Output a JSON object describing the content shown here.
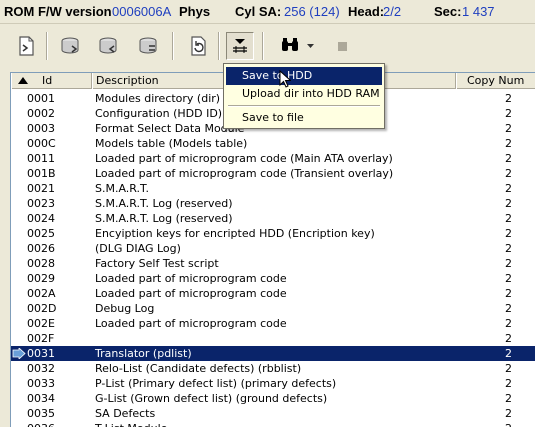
{
  "status": {
    "rom_label": "ROM F/W version",
    "rom_value": "0006006A",
    "phys_label": "Phys",
    "cyl_label": "Cyl SA:",
    "cyl_value": "256 (124)",
    "head_label": "Head:",
    "head_value": "2/2",
    "sec_label": "Sec:",
    "sec_value": "1 437"
  },
  "toolbar": {
    "buttons": [
      "read-module-icon",
      "hdd-read-icon",
      "hdd-write-icon",
      "hdd-compare-icon",
      "refresh-icon",
      "save-dropdown-icon",
      "binoculars-icon",
      "stop-icon"
    ]
  },
  "table": {
    "columns": [
      "Id",
      "Description",
      "Copy Num"
    ],
    "rows": [
      {
        "id": "0001",
        "desc": "Modules directory (dir)",
        "num": "2"
      },
      {
        "id": "0002",
        "desc": "Configuration (HDD ID) (Pa",
        "num": "2"
      },
      {
        "id": "0003",
        "desc": "Format Select Data Module",
        "num": "2"
      },
      {
        "id": "000C",
        "desc": "Models table (Models table)",
        "num": "2"
      },
      {
        "id": "0011",
        "desc": "Loaded part of microprogram code (Main ATA overlay)",
        "num": "2"
      },
      {
        "id": "001B",
        "desc": "Loaded part of microprogram code (Transient overlay)",
        "num": "2"
      },
      {
        "id": "0021",
        "desc": "S.M.A.R.T.",
        "num": "2"
      },
      {
        "id": "0023",
        "desc": "S.M.A.R.T. Log (reserved)",
        "num": "2"
      },
      {
        "id": "0024",
        "desc": "S.M.A.R.T. Log (reserved)",
        "num": "2"
      },
      {
        "id": "0025",
        "desc": "Encyiption keys for encripted HDD (Encription key)",
        "num": "2"
      },
      {
        "id": "0026",
        "desc": " (DLG DIAG Log)",
        "num": "2"
      },
      {
        "id": "0028",
        "desc": "Factory Self Test script",
        "num": "2"
      },
      {
        "id": "0029",
        "desc": "Loaded part of microprogram code",
        "num": "2"
      },
      {
        "id": "002A",
        "desc": "Loaded part of microprogram code",
        "num": "2"
      },
      {
        "id": "002D",
        "desc": "Debug Log",
        "num": "2"
      },
      {
        "id": "002E",
        "desc": "Loaded part of microprogram code",
        "num": "2"
      },
      {
        "id": "002F",
        "desc": "",
        "num": "2"
      },
      {
        "id": "0031",
        "desc": "Translator (pdlist)",
        "num": "2"
      },
      {
        "id": "0032",
        "desc": "Relo-List (Candidate defects) (rbblist)",
        "num": "2"
      },
      {
        "id": "0033",
        "desc": "P-List (Primary defect list) (primary defects)",
        "num": "2"
      },
      {
        "id": "0034",
        "desc": "G-List (Grown defect list) (ground defects)",
        "num": "2"
      },
      {
        "id": "0035",
        "desc": "SA Defects",
        "num": "2"
      },
      {
        "id": "0036",
        "desc": "T-List Module",
        "num": "2"
      }
    ],
    "selected_index": 17
  },
  "menu": {
    "items": [
      "Save to HDD",
      "Upload dir into HDD RAM",
      "Save to file"
    ]
  }
}
